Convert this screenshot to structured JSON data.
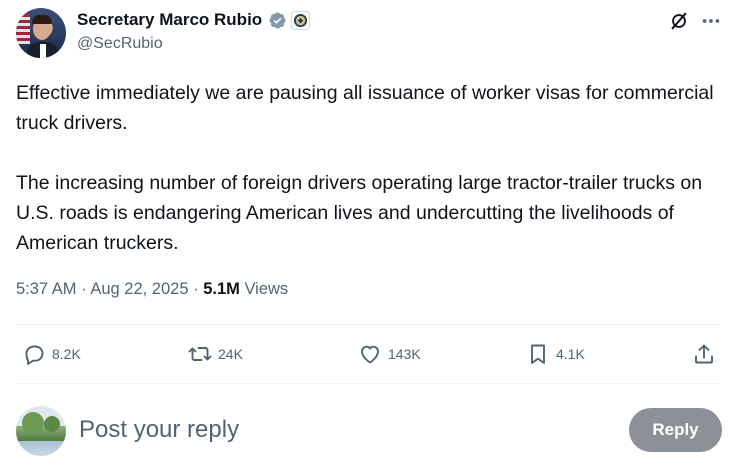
{
  "author": {
    "display_name": "Secretary Marco Rubio",
    "handle": "@SecRubio",
    "verified_icon": "verified-badge-icon",
    "affiliation_icon": "state-department-seal-icon"
  },
  "header_actions": {
    "grok_icon": "grok-icon",
    "more_icon": "more-options-icon"
  },
  "tweet": {
    "paragraphs": [
      "Effective immediately we are pausing all issuance of worker visas for commercial truck drivers.",
      "The increasing number of foreign drivers operating large tractor-trailer trucks on U.S. roads is endangering American lives and undercutting the livelihoods of American truckers."
    ],
    "time": "5:37 AM",
    "separator": "·",
    "date": "Aug 22, 2025",
    "views_count": "5.1M",
    "views_label": "Views"
  },
  "actions": {
    "replies": "8.2K",
    "reposts": "24K",
    "likes": "143K",
    "bookmarks": "4.1K"
  },
  "composer": {
    "placeholder": "Post your reply",
    "button_label": "Reply"
  },
  "colors": {
    "text_primary": "#0f1419",
    "text_secondary": "#536471",
    "verified_blue": "#829aab",
    "divider": "#eff3f4",
    "reply_button_bg": "#8b9196"
  }
}
